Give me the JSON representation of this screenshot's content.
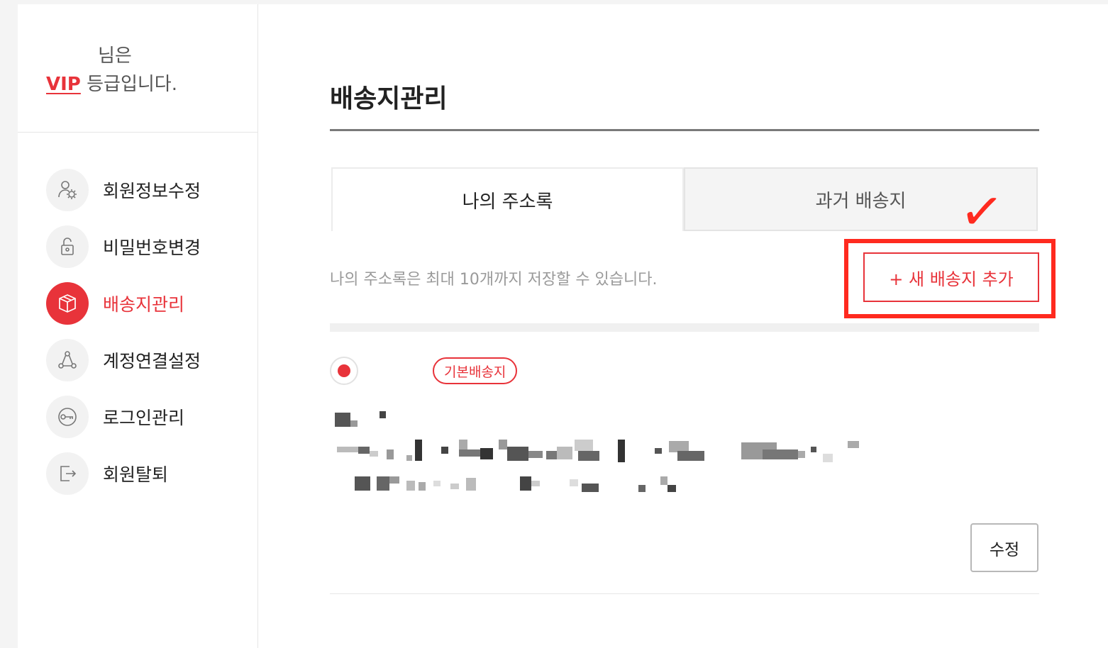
{
  "sidebar": {
    "member_suffix": "님은",
    "grade": "VIP",
    "grade_suffix": "등급입니다.",
    "menu": [
      {
        "label": "회원정보수정",
        "icon": "user-gear-icon",
        "active": false
      },
      {
        "label": "비밀번호변경",
        "icon": "unlock-icon",
        "active": false
      },
      {
        "label": "배송지관리",
        "icon": "box-icon",
        "active": true
      },
      {
        "label": "계정연결설정",
        "icon": "link-nodes-icon",
        "active": false
      },
      {
        "label": "로그인관리",
        "icon": "key-icon",
        "active": false
      },
      {
        "label": "회원탈퇴",
        "icon": "exit-icon",
        "active": false
      }
    ]
  },
  "main": {
    "title": "배송지관리",
    "tabs": [
      {
        "label": "나의 주소록",
        "selected": true
      },
      {
        "label": "과거 배송지",
        "selected": false
      }
    ],
    "limit_notice": "나의 주소록은 최대 10개까지 저장할 수 있습니다.",
    "add_button": "+ 새 배송지 추가",
    "annotation_mark": "✓",
    "address_card": {
      "badge": "기본배송지",
      "default_selected": true,
      "edit_button": "수정"
    }
  },
  "colors": {
    "accent": "#e8333a",
    "annotation": "#ff2a1f"
  }
}
